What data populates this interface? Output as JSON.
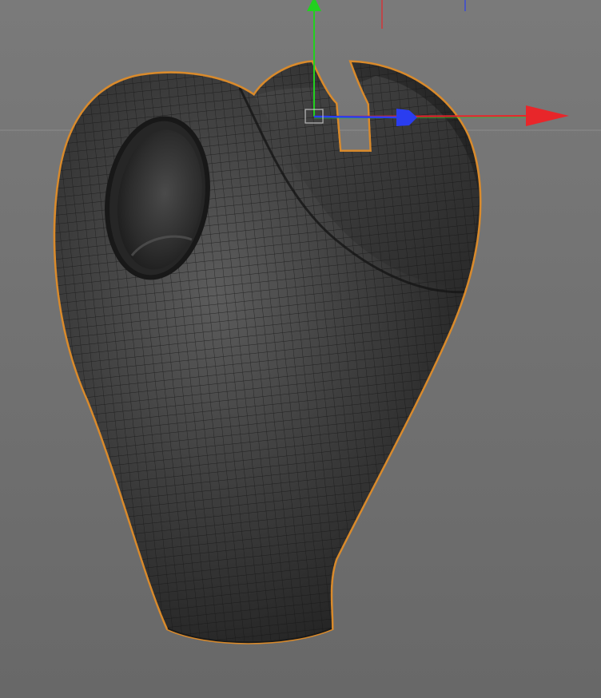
{
  "viewport": {
    "background_color": "#727272",
    "horizon_color": "#8c8c8c"
  },
  "object": {
    "surface_color": "#3a3a3a",
    "highlight_color": "#5c5c5c",
    "wire_color": "#141414",
    "selection_outline_color": "#d98a2b"
  },
  "gizmo": {
    "x_axis_color": "#e8262a",
    "y_axis_color": "#22d11f",
    "z_axis_color": "#2a3df0",
    "x_axis_icon": "arrow-right-icon",
    "y_axis_icon": "arrow-up-icon",
    "z_axis_icon": "sphere-handle-icon",
    "center_icon": "square-handle-icon"
  }
}
